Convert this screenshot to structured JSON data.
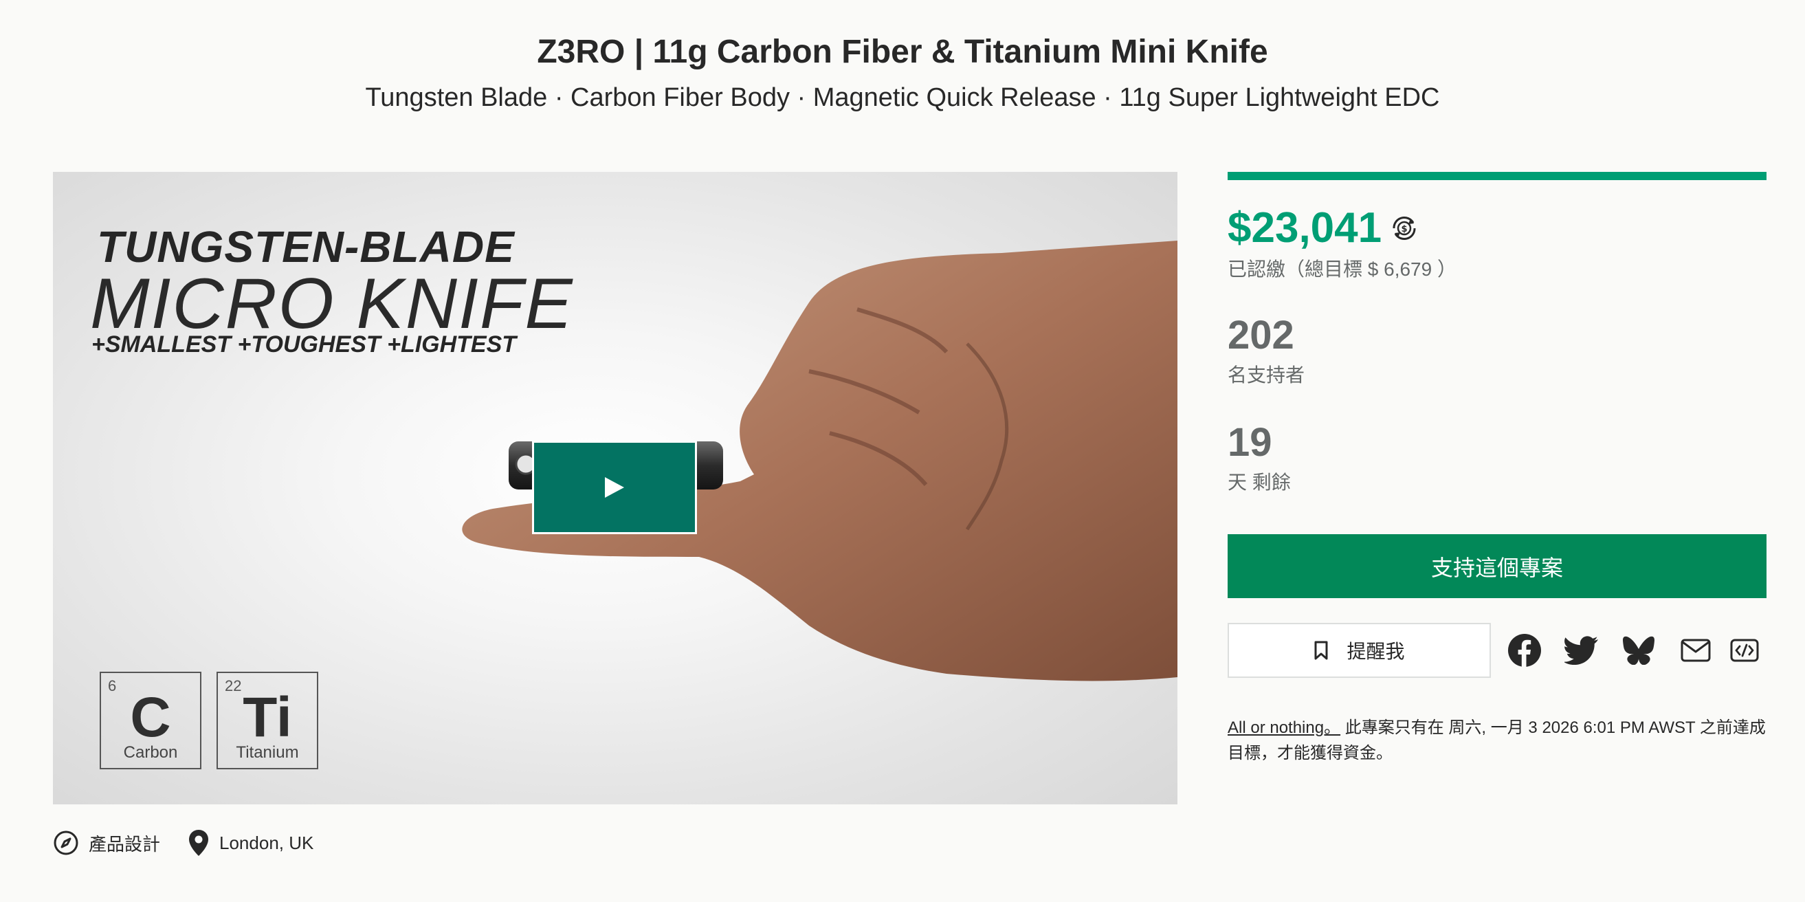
{
  "project": {
    "title": "Z3RO | 11g Carbon Fiber & Titanium Mini Knife",
    "subtitle": "Tungsten Blade · Carbon Fiber Body · Magnetic Quick Release · 11g Super Lightweight EDC"
  },
  "media": {
    "promo_line1": "TUNGSTEN-BLADE",
    "promo_line2": "MICRO KNIFE",
    "promo_line3": "+SMALLEST +TOUGHEST +LIGHTEST",
    "elements": [
      {
        "number": "6",
        "symbol": "C",
        "name": "Carbon"
      },
      {
        "number": "22",
        "symbol": "Ti",
        "name": "Titanium"
      }
    ]
  },
  "meta": {
    "category": "產品設計",
    "location": "London, UK"
  },
  "funding": {
    "progress_percent": 100,
    "pledged": "$23,041",
    "pledged_note": "已認繳（總目標 $ 6,679 ）",
    "backers": "202",
    "backers_label": "名支持者",
    "days": "19",
    "days_label": "天 剩餘"
  },
  "actions": {
    "back_label": "支持這個專案",
    "remind_label": "提醒我"
  },
  "share": [
    "facebook-icon",
    "twitter-icon",
    "bluesky-icon",
    "mail-icon",
    "embed-icon"
  ],
  "fine_print": {
    "link": "All or nothing。",
    "text": " 此專案只有在 周六, 一月 3 2026 6:01 PM AWST 之前達成目標，才能獲得資金。"
  },
  "colors": {
    "accent": "#009e74",
    "button": "#028858",
    "play": "#037362",
    "muted": "#656969"
  }
}
